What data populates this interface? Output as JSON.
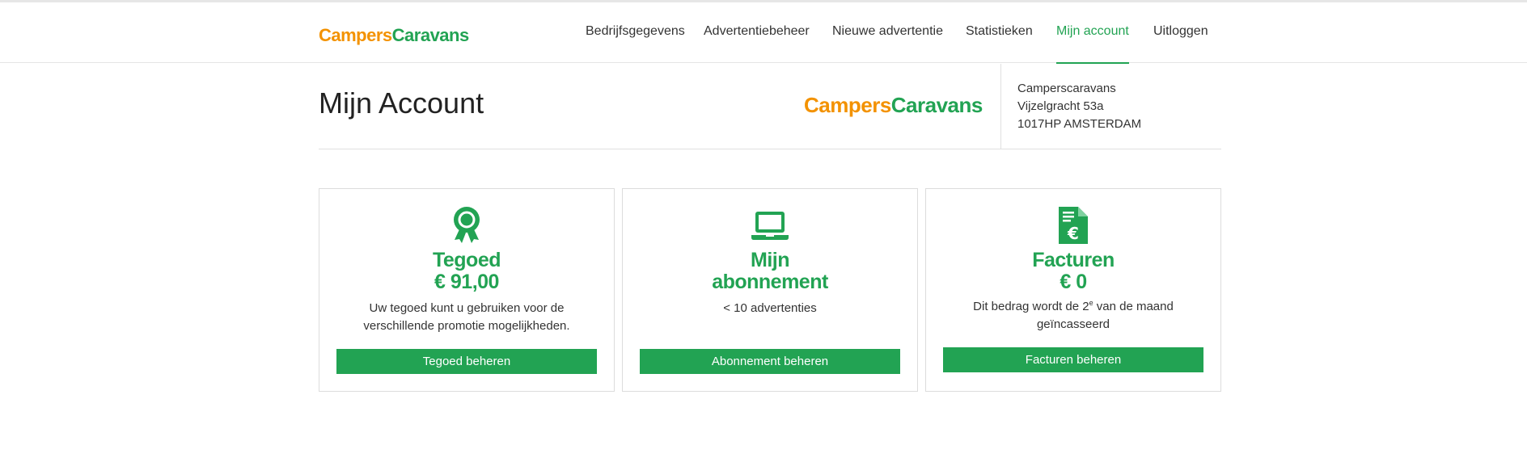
{
  "brand": {
    "part1": "Campers",
    "part2": "Caravans"
  },
  "nav": {
    "items": [
      {
        "label": "Bedrijfsgegevens",
        "active": false
      },
      {
        "label": "Advertentiebeheer",
        "active": false
      },
      {
        "label": "Nieuwe advertentie",
        "active": false
      },
      {
        "label": "Statistieken",
        "active": false
      },
      {
        "label": "Mijn account",
        "active": true
      },
      {
        "label": "Uitloggen",
        "active": false
      }
    ]
  },
  "account": {
    "title": "Mijn Account",
    "address": {
      "name": "Camperscaravans",
      "street": "Vijzelgracht 53a",
      "city": "1017HP AMSTERDAM"
    }
  },
  "cards": {
    "credit": {
      "title_line1": "Tegoed",
      "title_line2": "€ 91,00",
      "desc_line1": "Uw tegoed kunt u gebruiken voor de",
      "desc_line2": "verschillende promotie mogelijkheden.",
      "button": "Tegoed beheren",
      "icon": "award-ribbon-icon"
    },
    "subscription": {
      "title_line1": "Mijn",
      "title_line2": "abonnement",
      "desc_line1": "< 10 advertenties",
      "button": "Abonnement beheren",
      "icon": "laptop-icon"
    },
    "invoices": {
      "title_line1": "Facturen",
      "title_line2": "€ 0",
      "desc_part1": "Dit bedrag wordt de 2",
      "desc_sup": "e",
      "desc_part2": " van de maand",
      "desc_line2": "geïncasseerd",
      "button": "Facturen beheren",
      "icon": "euro-invoice-icon"
    }
  },
  "colors": {
    "accent_green": "#22a353",
    "brand_orange": "#f39200"
  }
}
